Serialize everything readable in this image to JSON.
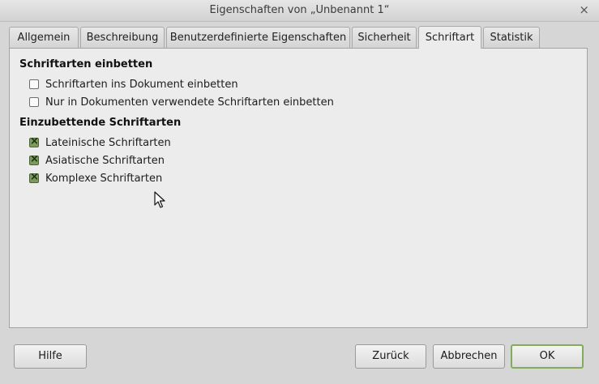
{
  "window": {
    "title": "Eigenschaften von „Unbenannt 1“",
    "close_glyph": "×"
  },
  "tabs": [
    {
      "label": "Allgemein"
    },
    {
      "label": "Beschreibung"
    },
    {
      "label": "Benutzerdefinierte Eigenschaften"
    },
    {
      "label": "Sicherheit"
    },
    {
      "label": "Schriftart",
      "active": true
    },
    {
      "label": "Statistik"
    }
  ],
  "embed": {
    "heading": "Schriftarten einbetten",
    "options": [
      {
        "label": "Schriftarten ins Dokument einbetten",
        "checked": false
      },
      {
        "label": "Nur in Dokumenten verwendete Schriftarten einbetten",
        "checked": false
      }
    ]
  },
  "scripts": {
    "heading": "Einzubettende Schriftarten",
    "options": [
      {
        "label": "Lateinische Schriftarten",
        "checked": true
      },
      {
        "label": "Asiatische Schriftarten",
        "checked": true
      },
      {
        "label": "Komplexe Schriftarten",
        "checked": true
      }
    ]
  },
  "buttons": {
    "help": "Hilfe",
    "reset": "Zurück",
    "cancel": "Abbrechen",
    "ok": "OK"
  },
  "colors": {
    "checkbox_checked": "#7c9a5e",
    "default_button_border": "#84aa5c"
  }
}
